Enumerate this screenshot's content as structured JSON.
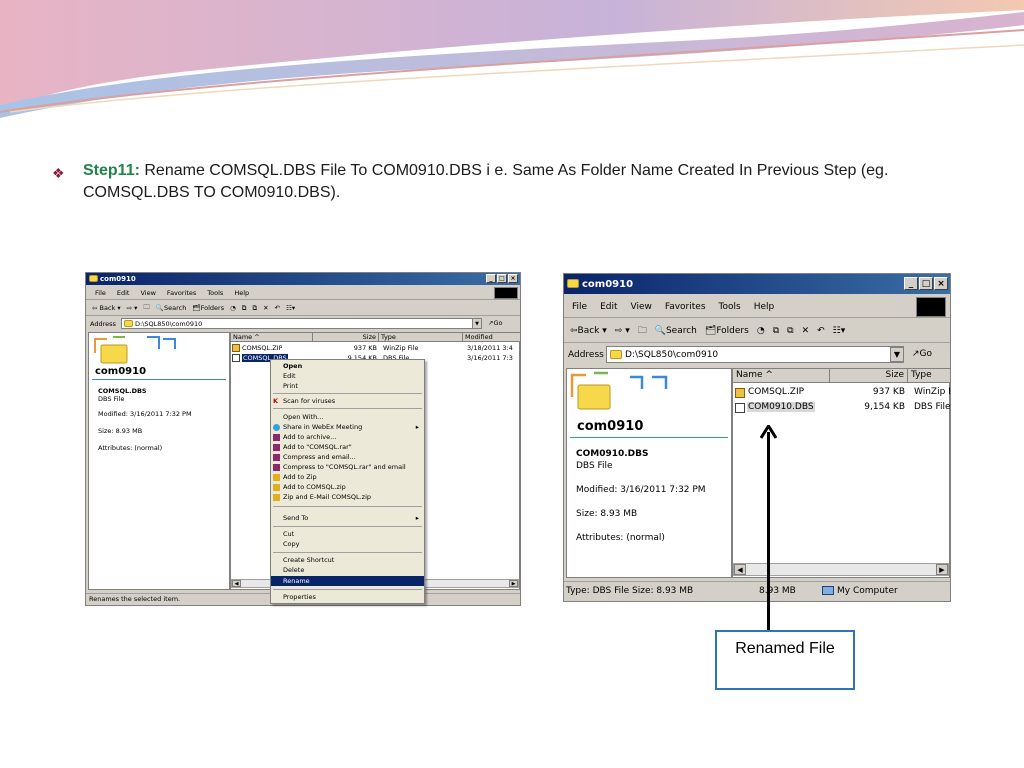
{
  "slide": {
    "step_label": "Step11:",
    "step_text": " Rename COMSQL.DBS File To COM0910.DBS i e.  Same As Folder Name Created In Previous Step (eg. COMSQL.DBS TO COM0910.DBS).",
    "callout": "Renamed File",
    "colors": {
      "step_label": "#1e8449",
      "bullet": "#8b1a3a",
      "callout_border": "#2e75b6",
      "titlebar": "#0a246a"
    }
  },
  "left_window": {
    "title": "com0910",
    "menu": [
      "File",
      "Edit",
      "View",
      "Favorites",
      "Tools",
      "Help"
    ],
    "toolbar": {
      "back": "Back",
      "search": "Search",
      "folders": "Folders"
    },
    "address_label": "Address",
    "address_value": "D:\\SQL850\\com0910",
    "go": "Go",
    "folder_name": "com0910",
    "details": {
      "file_name": "COMSQL.DBS",
      "file_type": "DBS File",
      "modified": "Modified: 3/16/2011 7:32 PM",
      "size": "Size: 8.93 MB",
      "attributes": "Attributes: (normal)"
    },
    "columns": [
      "Name",
      "Size",
      "Type",
      "Modified"
    ],
    "files": [
      {
        "name": "COMSQL.ZIP",
        "size": "937 KB",
        "type": "WinZip File",
        "modified": "3/18/2011 3:4"
      },
      {
        "name": "COMSQL.DBS",
        "size": "9,154 KB",
        "type": "DBS File",
        "modified": "3/16/2011 7:3"
      }
    ],
    "status": "Renames the selected item.",
    "context_menu": [
      "Open",
      "Edit",
      "Print",
      "Scan for viruses",
      "Open With...",
      "Share in WebEx Meeting",
      "Add to archive...",
      "Add to \"COMSQL.rar\"",
      "Compress and email...",
      "Compress to \"COMSQL.rar\" and email",
      "Add to Zip",
      "Add to COMSQL.zip",
      "Zip and E-Mail COMSQL.zip",
      "Send To",
      "Cut",
      "Copy",
      "Create Shortcut",
      "Delete",
      "Rename",
      "Properties"
    ]
  },
  "right_window": {
    "title": "com0910",
    "menu": [
      "File",
      "Edit",
      "View",
      "Favorites",
      "Tools",
      "Help"
    ],
    "toolbar": {
      "back": "Back",
      "search": "Search",
      "folders": "Folders"
    },
    "address_label": "Address",
    "address_value": "D:\\SQL850\\com0910",
    "go": "Go",
    "folder_name": "com0910",
    "details": {
      "file_name": "COM0910.DBS",
      "file_type": "DBS File",
      "modified": "Modified: 3/16/2011 7:32 PM",
      "size": "Size: 8.93 MB",
      "attributes": "Attributes: (normal)"
    },
    "columns": [
      "Name",
      "Size",
      "Type"
    ],
    "files": [
      {
        "name": "COMSQL.ZIP",
        "size": "937 KB",
        "type": "WinZip F"
      },
      {
        "name": "COM0910.DBS",
        "size": "9,154 KB",
        "type": "DBS File"
      }
    ],
    "status": {
      "type": "Type: DBS File Size: 8.93 MB",
      "size": "8.93 MB",
      "location": "My Computer"
    }
  }
}
